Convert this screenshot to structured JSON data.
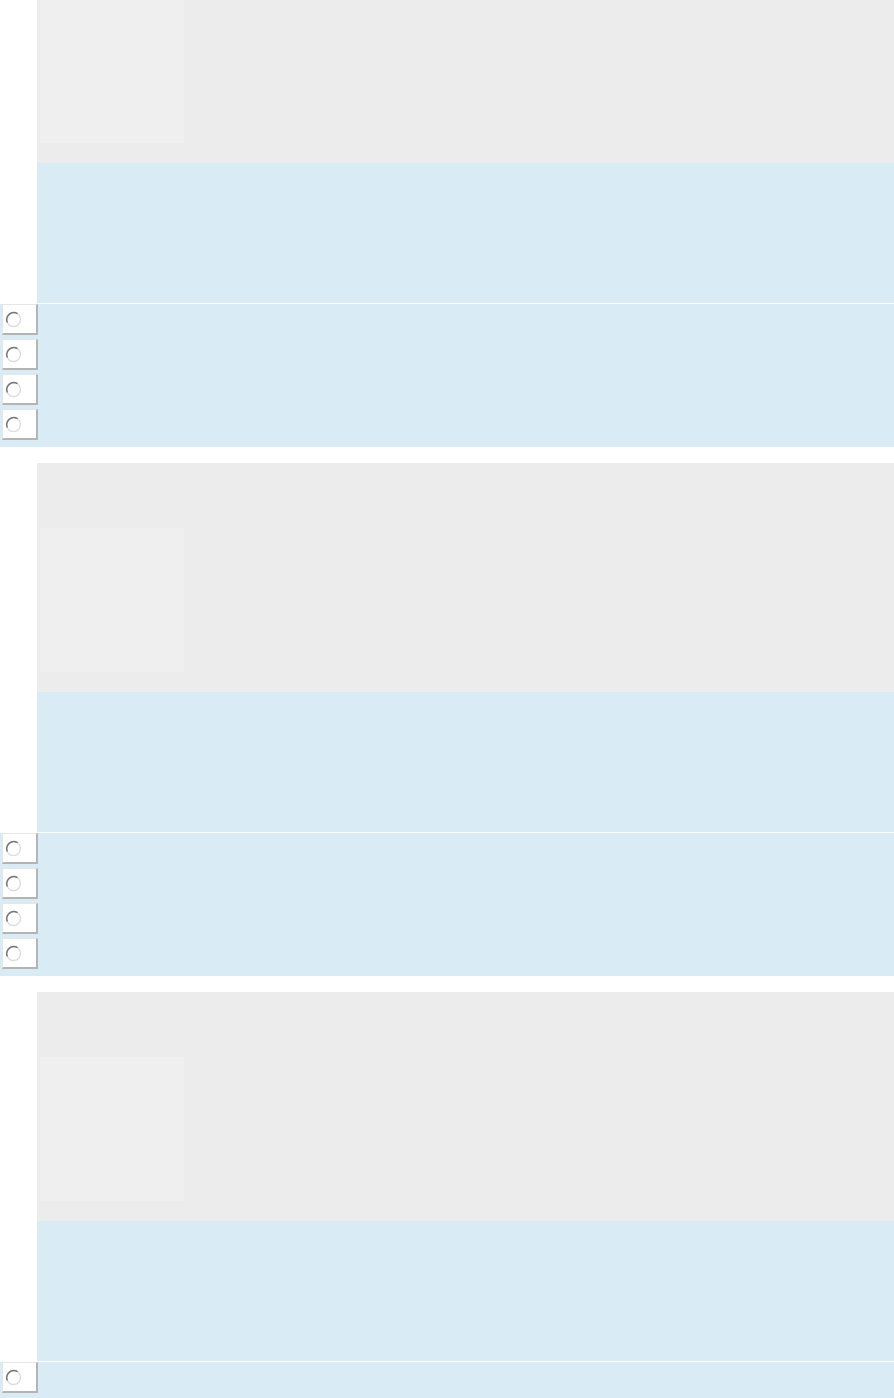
{
  "questions": [
    {
      "options": [
        {
          "selected": false
        },
        {
          "selected": false
        },
        {
          "selected": false
        },
        {
          "selected": false
        }
      ]
    },
    {
      "options": [
        {
          "selected": false
        },
        {
          "selected": false
        },
        {
          "selected": false
        },
        {
          "selected": false
        }
      ]
    },
    {
      "options": [
        {
          "selected": false
        }
      ]
    }
  ]
}
